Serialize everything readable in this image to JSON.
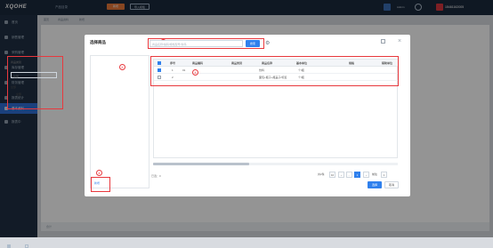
{
  "app": {
    "logo": "XQOHE",
    "crumb": "产品目录"
  },
  "topbar": {
    "orange_button": "新增",
    "outline_button": "导入模板",
    "user_name": "15461162005",
    "user_short": "Admin"
  },
  "sidebar": {
    "items": [
      {
        "label": "首页"
      },
      {
        "label": "销售管理"
      },
      {
        "label": "采购管理"
      },
      {
        "label": "库存管理"
      },
      {
        "label": "财务管理"
      },
      {
        "label": "报表统计"
      },
      {
        "label": "基本资料"
      },
      {
        "label": "报表中"
      }
    ]
  },
  "background": {
    "tabs": [
      "首页",
      "商品资料",
      "新增"
    ],
    "bottom_text": "合计"
  },
  "modal": {
    "title": "选择商品",
    "search_placeholder": "商品名称/编码/规格型号/条码",
    "search_button": "搜索",
    "category_label": "商品类别",
    "category_select": "全部",
    "tree_root": "全部",
    "tree_child": "全部",
    "add_button": "新增",
    "confirm_button": "选择",
    "cancel_button": "取消",
    "selected_count": "已选：0",
    "badges": {
      "left": "④",
      "search": "①",
      "table": "③",
      "add": "②"
    },
    "table": {
      "headers": [
        "序号",
        "商品编码",
        "商品类别",
        "商品名称",
        "基本单位",
        "规格",
        "辅助单位"
      ],
      "rows": [
        {
          "no": "1",
          "code": "01",
          "category": "",
          "name": "饮料",
          "unit": "个/瓶",
          "spec": "",
          "aux": ""
        },
        {
          "no": "2",
          "code": "",
          "category": "",
          "name": "面包+瓶子+瓶盖子/标签",
          "unit": "个/瓶",
          "spec": "",
          "aux": ""
        }
      ]
    },
    "pager": {
      "prefix": "共2条",
      "page_size": "10",
      "pages": [
        "1"
      ],
      "current": "1",
      "goto": "前往",
      "goto_page": "1"
    }
  }
}
